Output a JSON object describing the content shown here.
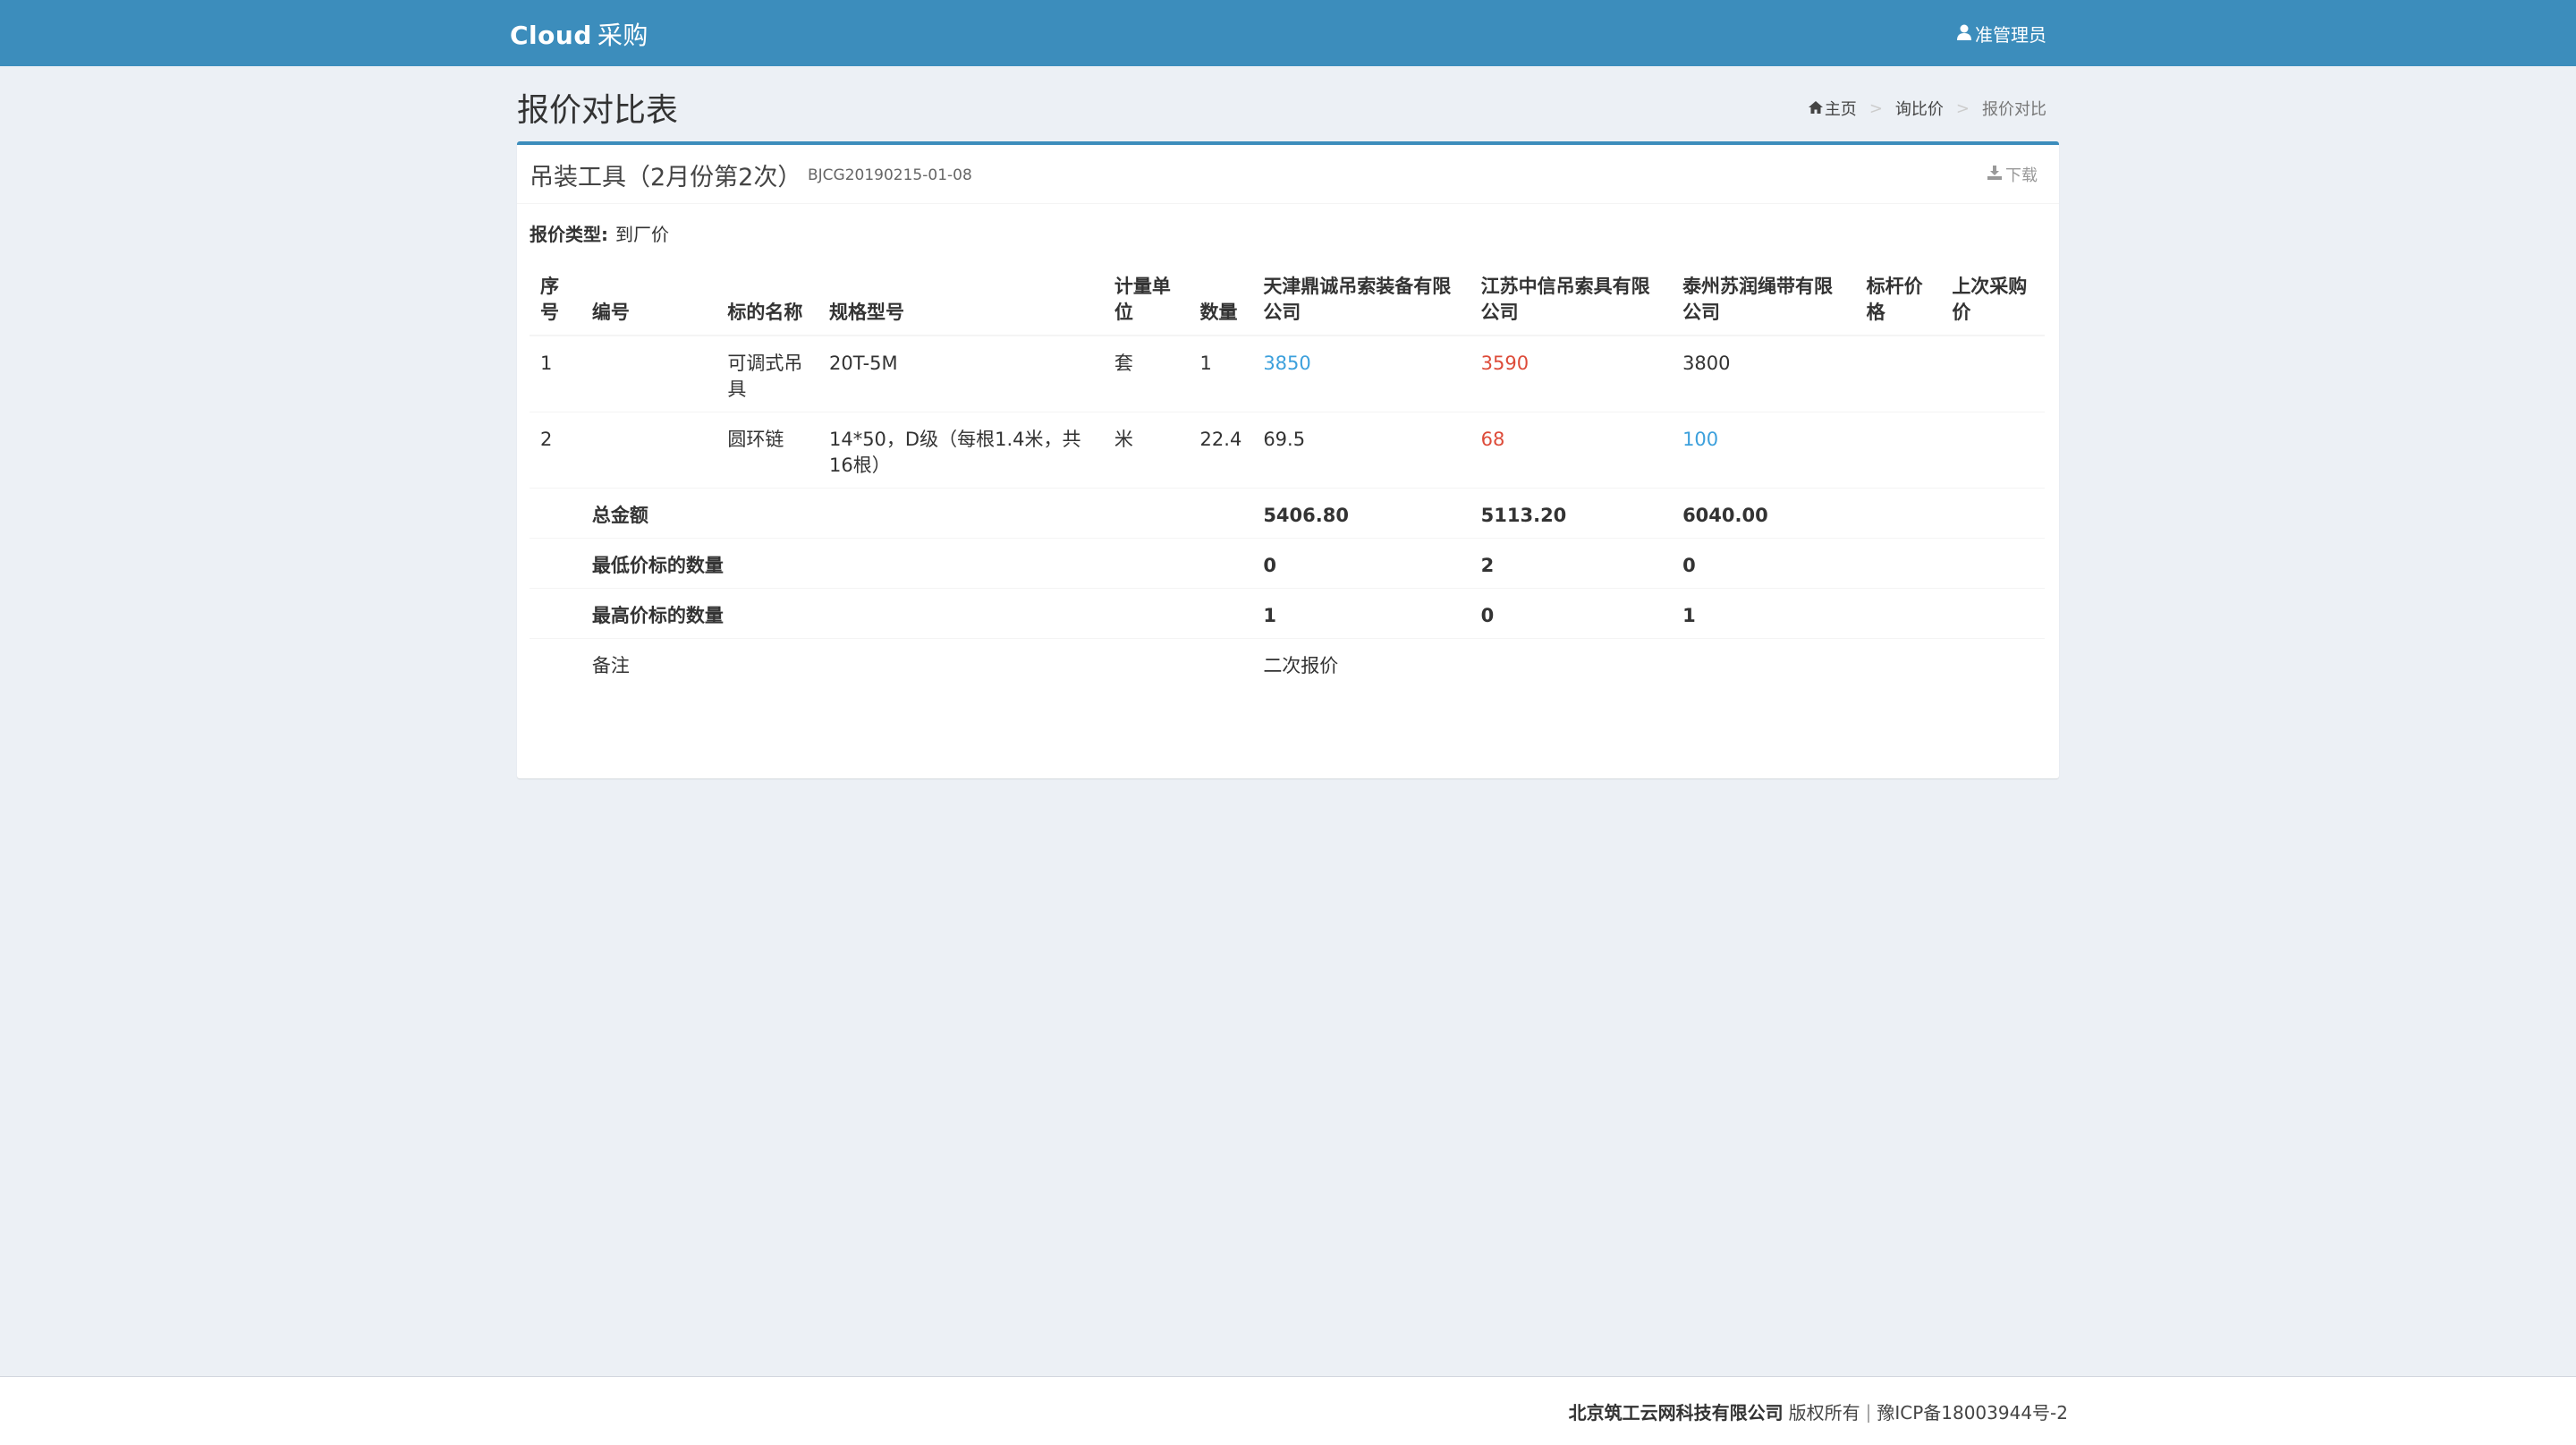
{
  "navbar": {
    "brand": "Cloud",
    "brand_sub": "采购",
    "user": "准管理员"
  },
  "header": {
    "title": "报价对比表",
    "breadcrumb": [
      "主页",
      "询比价",
      "报价对比"
    ]
  },
  "box": {
    "title": "吊装工具（2月份第2次）",
    "code": "BJCG20190215-01-08",
    "download": "下载",
    "quote_type_label": "报价类型:",
    "quote_type_value": "到厂价"
  },
  "table": {
    "headers": {
      "seq": "序号",
      "code": "编号",
      "name": "标的名称",
      "spec": "规格型号",
      "unit": "计量单位",
      "qty": "数量",
      "s1": "天津鼎诚吊索装备有限公司",
      "s2": "江苏中信吊索具有限公司",
      "s3": "泰州苏润绳带有限公司",
      "benchmark": "标杆价格",
      "last": "上次采购价"
    },
    "rows": [
      {
        "seq": "1",
        "code": "",
        "name": "可调式吊具",
        "spec": "20T-5M",
        "unit": "套",
        "qty": "1",
        "s1": "3850",
        "s2": "3590",
        "s3": "3800",
        "benchmark": "",
        "last": ""
      },
      {
        "seq": "2",
        "code": "",
        "name": "圆环链",
        "spec": "14*50，D级（每根1.4米，共16根）",
        "unit": "米",
        "qty": "22.4",
        "s1": "69.5",
        "s2": "68",
        "s3": "100",
        "benchmark": "",
        "last": ""
      }
    ],
    "summary": {
      "total_label": "总金额",
      "total": [
        "5406.80",
        "5113.20",
        "6040.00"
      ],
      "lowest_label": "最低价标的数量",
      "lowest": [
        "0",
        "2",
        "0"
      ],
      "highest_label": "最高价标的数量",
      "highest": [
        "1",
        "0",
        "1"
      ],
      "remark_label": "备注",
      "remark": "二次报价"
    },
    "colors": {
      "lowest": "#dd4b39",
      "highest": "#3ca0dc"
    }
  },
  "footer": {
    "company": "北京筑工云网科技有限公司",
    "rights": "版权所有",
    "icp": "豫ICP备18003944号-2"
  }
}
